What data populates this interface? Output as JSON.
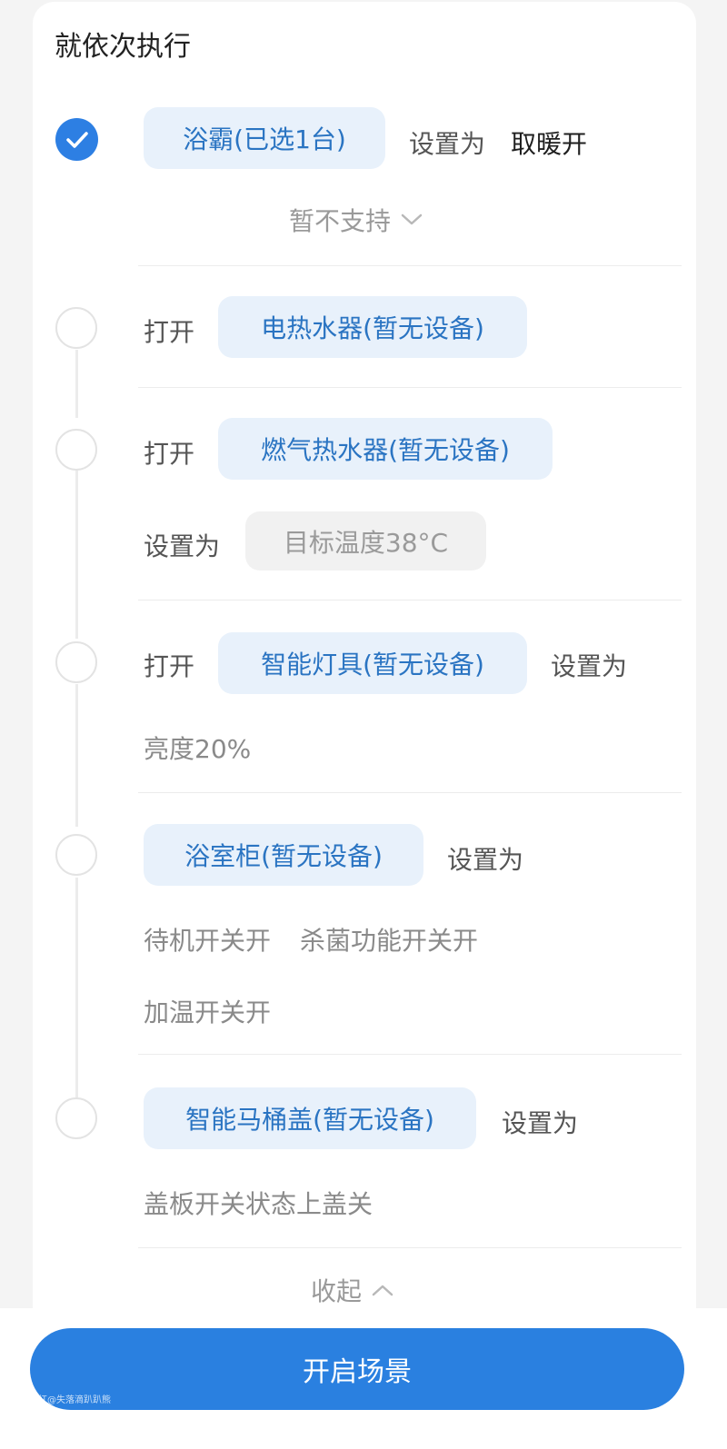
{
  "section": {
    "title": "就依次执行"
  },
  "steps": [
    {
      "device": "浴霸(已选1台)",
      "set_label": "设置为",
      "value": "取暖开",
      "note": "暂不支持"
    },
    {
      "action": "打开",
      "device": "电热水器(暂无设备)"
    },
    {
      "action": "打开",
      "device": "燃气热水器(暂无设备)",
      "set_label": "设置为",
      "value": "目标温度38°C"
    },
    {
      "action": "打开",
      "device": "智能灯具(暂无设备)",
      "set_label": "设置为",
      "value": "亮度20%"
    },
    {
      "device": "浴室柜(暂无设备)",
      "set_label": "设置为",
      "values": [
        "待机开关开",
        "杀菌功能开关开",
        "加温开关开"
      ]
    },
    {
      "device": "智能马桶盖(暂无设备)",
      "set_label": "设置为",
      "value": "盖板开关状态上盖关"
    }
  ],
  "collapse_label": "收起",
  "primary_button": "开启场景",
  "watermark": "@小红@失落滴趴趴熊",
  "colors": {
    "accent": "#2a80e0",
    "pill_bg": "#e8f1fb",
    "pill_text": "#2a74c2"
  }
}
